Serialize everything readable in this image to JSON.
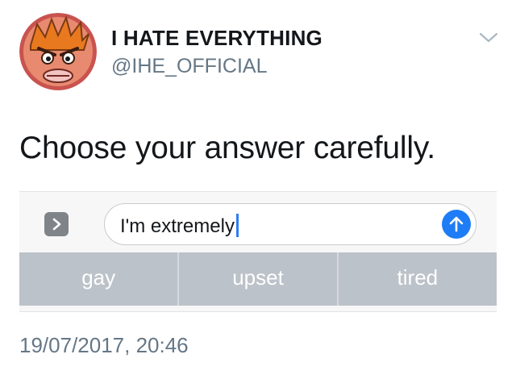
{
  "tweet": {
    "display_name": "I HATE EVERYTHING",
    "handle": "@IHE_OFFICIAL",
    "text": "Choose your answer carefully.",
    "timestamp": "19/07/2017, 20:46"
  },
  "icons": {
    "avatar": "angry-cartoon-face-avatar",
    "menu": "chevron-down-icon",
    "expand": "chevron-right-icon",
    "send": "arrow-up-icon"
  },
  "imessage": {
    "input_value": "I'm extremely",
    "suggestions": [
      "gay",
      "upset",
      "tired"
    ]
  },
  "colors": {
    "send_button": "#1e7cf6",
    "suggestion_bar": "#bcc2c9",
    "secondary_text": "#657786"
  }
}
